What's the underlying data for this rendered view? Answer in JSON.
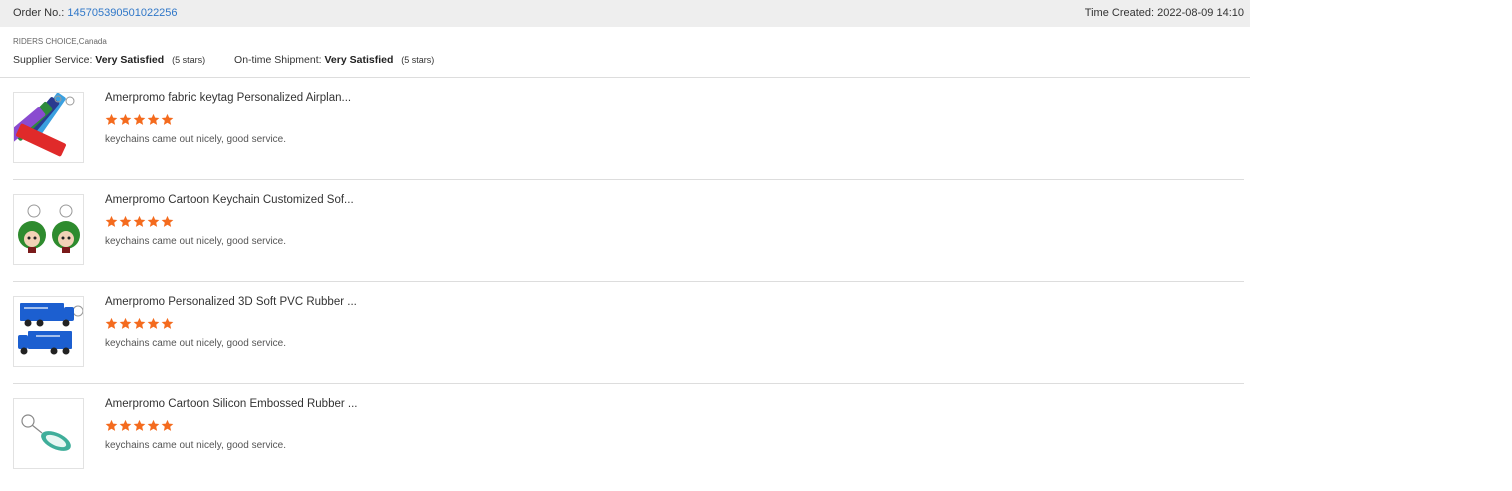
{
  "order": {
    "label": "Order No.:",
    "number": "145705390501022256",
    "time_label": "Time Created:",
    "time_value": "2022-08-09 14:10"
  },
  "supplier": {
    "name": "RIDERS CHOICE,Canada",
    "service_label": "Supplier Service:",
    "service_value": "Very Satisfied",
    "service_stars": "(5 stars)",
    "shipment_label": "On-time Shipment:",
    "shipment_value": "Very Satisfied",
    "shipment_stars": "(5 stars)"
  },
  "colors": {
    "star": "#f46b1e",
    "link": "#2f77c8",
    "bar": "#eeeeee"
  },
  "reviews": [
    {
      "title": "Amerpromo fabric keytag Personalized Airplan...",
      "rating": 5,
      "comment": "keychains came out nicely, good service.",
      "image": "fabric-keytag-image"
    },
    {
      "title": "Amerpromo Cartoon Keychain Customized Sof...",
      "rating": 5,
      "comment": "keychains came out nicely, good service.",
      "image": "cartoon-keychain-image"
    },
    {
      "title": "Amerpromo Personalized 3D Soft PVC Rubber ...",
      "rating": 5,
      "comment": "keychains came out nicely, good service.",
      "image": "truck-keychain-image"
    },
    {
      "title": "Amerpromo Cartoon Silicon Embossed Rubber ...",
      "rating": 5,
      "comment": "keychains came out nicely, good service.",
      "image": "silicon-keychain-image"
    }
  ]
}
